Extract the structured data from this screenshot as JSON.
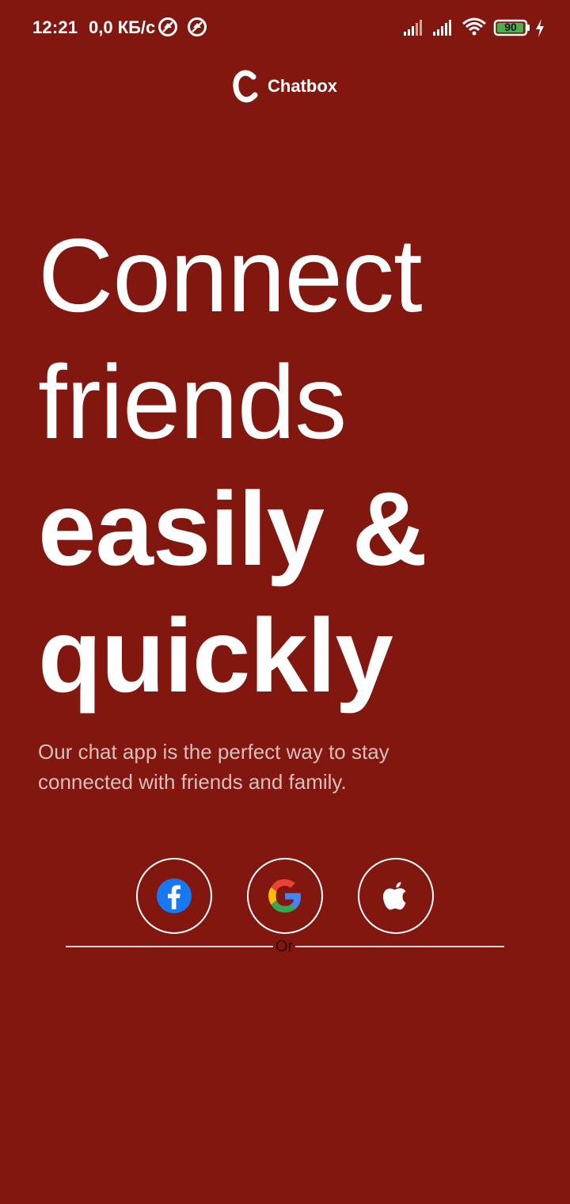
{
  "status_bar": {
    "time": "12:21",
    "network_speed": "0,0 КБ/с",
    "battery_level": "90",
    "icons": [
      "notification-icon",
      "notification-icon",
      "signal-icon",
      "signal-icon",
      "wifi-icon",
      "battery-icon",
      "charging-icon"
    ]
  },
  "brand": {
    "name": "Chatbox",
    "logo_icon": "chatbox-logo-icon"
  },
  "headline": {
    "line1": "Connect",
    "line2": "friends",
    "line3": "easily &",
    "line4": "quickly"
  },
  "subtitle": "Our chat app is the perfect way to stay connected with friends and family.",
  "social_buttons": [
    {
      "icon": "facebook-icon",
      "color": "#1877F2"
    },
    {
      "icon": "google-icon",
      "colors": [
        "#4285F4",
        "#EA4335",
        "#FBBC05",
        "#34A853"
      ]
    },
    {
      "icon": "apple-icon",
      "color": "#ffffff"
    }
  ],
  "divider": {
    "label": "Or"
  },
  "colors": {
    "background": "#821710",
    "text": "#ffffff",
    "subtitle": "#d9bfbc"
  }
}
